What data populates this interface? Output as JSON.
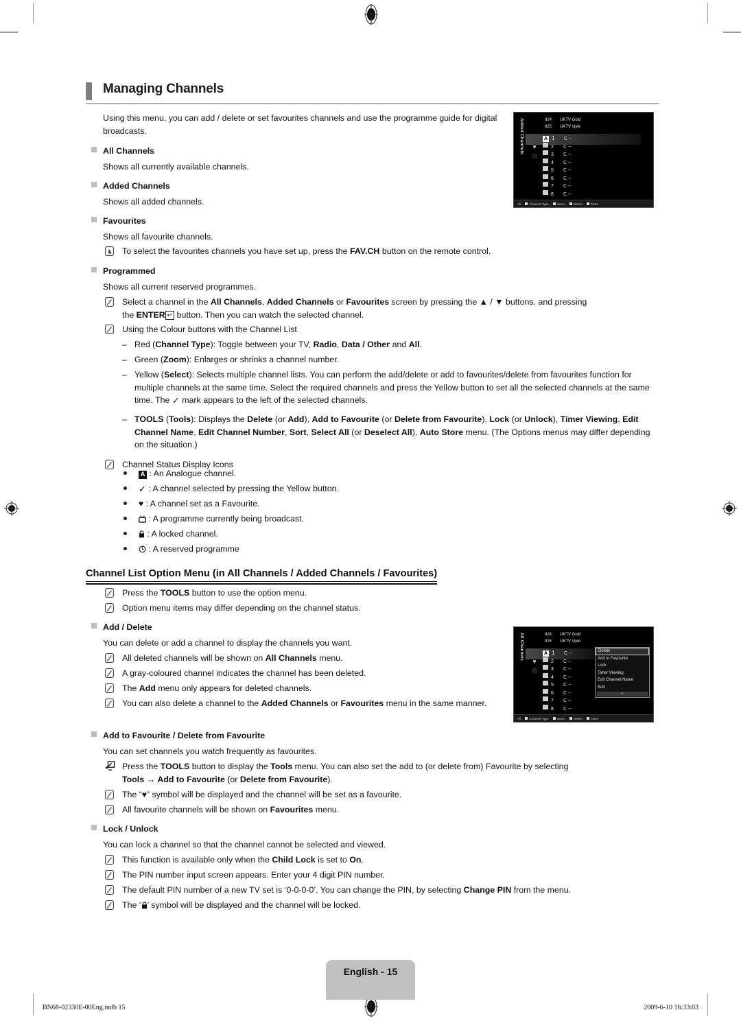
{
  "page": {
    "section_title": "Managing Channels",
    "intro": "Using this menu, you can add / delete or set favourites channels and use the programme guide for digital broadcasts."
  },
  "blocks": {
    "all_channels": {
      "heading": "All Channels",
      "text": "Shows all currently available channels."
    },
    "added_channels": {
      "heading": "Added Channels",
      "text": "Shows all added channels."
    },
    "favourites": {
      "heading": "Favourites",
      "text": "Shows all favourite channels.",
      "note": "To select the favourites channels you have set up, press the FAV.CH button on the remote control.",
      "note_bold": "FAV.CH"
    },
    "programmed": {
      "heading": "Programmed",
      "text": "Shows all current reserved programmes."
    }
  },
  "notes": {
    "select_channel_1": "Select a channel in the All Channels, Added Channels or Favourites screen by pressing the ▲ / ▼ buttons, and pressing",
    "select_channel_2": "the ENTER button. Then you can watch the selected channel.",
    "colour_buttons": "Using the Colour buttons with the Channel List",
    "status_icons": "Channel Status Display Icons"
  },
  "colour_buttons": [
    {
      "label": "Red",
      "paren": "Channel Type",
      "text": ": Toggle between your TV, Radio, Data / Other and All."
    },
    {
      "label": "Green",
      "paren": "Zoom",
      "text": ": Enlarges or shrinks a channel number."
    },
    {
      "label": "Yellow",
      "paren": "Select",
      "text": ": Selects multiple channel lists. You can perform the add/delete or add to favourites/delete from favourites function for multiple channels at the same time. Select the required channels and press the Yellow button to set all the selected channels at the same time. The ✓ mark appears to the left of the selected channels."
    },
    {
      "label": "TOOLS",
      "paren": "Tools",
      "text": ": Displays the Delete (or Add), Add to Favourite (or Delete from Favourite), Lock (or Unlock), Timer Viewing, Edit Channel Name, Edit Channel Number, Sort, Select All (or Deselect All), Auto Store menu. (The Options menus may differ depending on the situation.)"
    }
  ],
  "status_icons": [
    {
      "icon": "analogue-channel-icon",
      "glyph": "A",
      "text": ": An Analogue channel."
    },
    {
      "icon": "check-mark-icon",
      "glyph": "✓",
      "text": ": A channel selected by pressing the Yellow button."
    },
    {
      "icon": "heart-icon",
      "glyph": "♥",
      "text": ": A channel set as a Favourite."
    },
    {
      "icon": "tv-broadcast-icon",
      "glyph": "☗",
      "text": ": A programme currently being broadcast."
    },
    {
      "icon": "lock-icon",
      "glyph": "▭",
      "text": ": A locked channel."
    },
    {
      "icon": "clock-icon",
      "glyph": "◴",
      "text": ": A reserved programme"
    }
  ],
  "option_menu": {
    "heading": "Channel List Option Menu (in All Channels / Added Channels / Favourites)",
    "note_1": "Press the TOOLS button to use the option menu.",
    "note_2": "Option menu items may differ depending on the channel status."
  },
  "add_delete": {
    "heading": "Add / Delete",
    "text": "You can delete or add a channel to display the channels you want.",
    "notes": [
      "All deleted channels will be shown on All Channels menu.",
      "A gray-coloured channel indicates the channel has been deleted.",
      "The Add menu only appears for deleted channels.",
      "You can also delete a channel to the Added Channels or Favourites menu in the same manner."
    ]
  },
  "favourite": {
    "heading": "Add to Favourite / Delete from Favourite",
    "text": "You can set channels you watch frequently as favourites.",
    "tools_note_1": "Press the TOOLS button to display the Tools menu. You can also set the add to (or delete from) Favourite by selecting",
    "tools_note_2": "Tools → Add to Favourite (or Delete from Favourite).",
    "note_heart": "The “♥” symbol will be displayed and the channel will be set as a favourite.",
    "note_all": "All favourite channels will be shown on Favourites menu."
  },
  "lock_unlock": {
    "heading": "Lock / Unlock",
    "text": "You can lock a channel so that the channel cannot be selected and viewed.",
    "notes": [
      "This function is available only when the Child Lock is set to On.",
      "The PIN number input screen appears. Enter your 4 digit PIN number.",
      "The default PIN number of a new TV set is ‘0-0-0-0’. You can change the PIN, by selecting Change PIN from the menu.",
      "The ‘▭’ symbol will be displayed and the channel will be locked."
    ]
  },
  "osd_added_channels": {
    "side_label": "Added Channels",
    "top_rows": [
      {
        "number": "824",
        "name": "UKTV Gold"
      },
      {
        "number": "825",
        "name": "UKTV style"
      }
    ],
    "channels": [
      {
        "type": "A",
        "no": "1",
        "label": "C --"
      },
      {
        "type": "D",
        "no": "2",
        "label": "C --"
      },
      {
        "type": "D",
        "no": "3",
        "label": "C --"
      },
      {
        "type": "D",
        "no": "4",
        "label": "C --"
      },
      {
        "type": "D",
        "no": "5",
        "label": "C --"
      },
      {
        "type": "D",
        "no": "6",
        "label": "C --"
      },
      {
        "type": "D",
        "no": "7",
        "label": "C --"
      },
      {
        "type": "D",
        "no": "8",
        "label": "C --"
      }
    ],
    "bottom_bar": {
      "all": "All",
      "channel_type": "Channel Type",
      "zoom": "Zoom",
      "select": "Select",
      "tools": "Tools"
    }
  },
  "osd_all_channels": {
    "side_label": "All Channels",
    "top_rows": [
      {
        "number": "824",
        "name": "UKTV Gold"
      },
      {
        "number": "825",
        "name": "UKTV style"
      }
    ],
    "channels": [
      {
        "type": "A",
        "no": "1",
        "label": "C --"
      },
      {
        "type": "D",
        "no": "2",
        "label": "C --"
      },
      {
        "type": "D",
        "no": "3",
        "label": "C --"
      },
      {
        "type": "D",
        "no": "4",
        "label": "C --"
      },
      {
        "type": "D",
        "no": "5",
        "label": "C --"
      },
      {
        "type": "D",
        "no": "6",
        "label": "C --"
      },
      {
        "type": "D",
        "no": "7",
        "label": "C --"
      },
      {
        "type": "D",
        "no": "8",
        "label": "C --"
      }
    ],
    "menu_items": [
      "Delete",
      "Add to Favourite",
      "Lock",
      "Timer Viewing",
      "Edit Channel Name",
      "Sort"
    ],
    "menu_more": "▪",
    "bottom_bar": {
      "all": "All",
      "channel_type": "Channel Type",
      "zoom": "Zoom",
      "select": "Select",
      "tools": "Tools"
    }
  },
  "footer": {
    "page_tab": "English - 15",
    "file_ref": "BN68-02330E-00Eng.indb   15",
    "timestamp": "2009-6-10   16:33:03"
  },
  "colors": {
    "header_bar": "#7d7d7d",
    "header_rule": "#b3b3b3",
    "bullet_square": "#bdbdbd",
    "page_tab": "#c0c0c0",
    "osd_background": "#000000"
  }
}
